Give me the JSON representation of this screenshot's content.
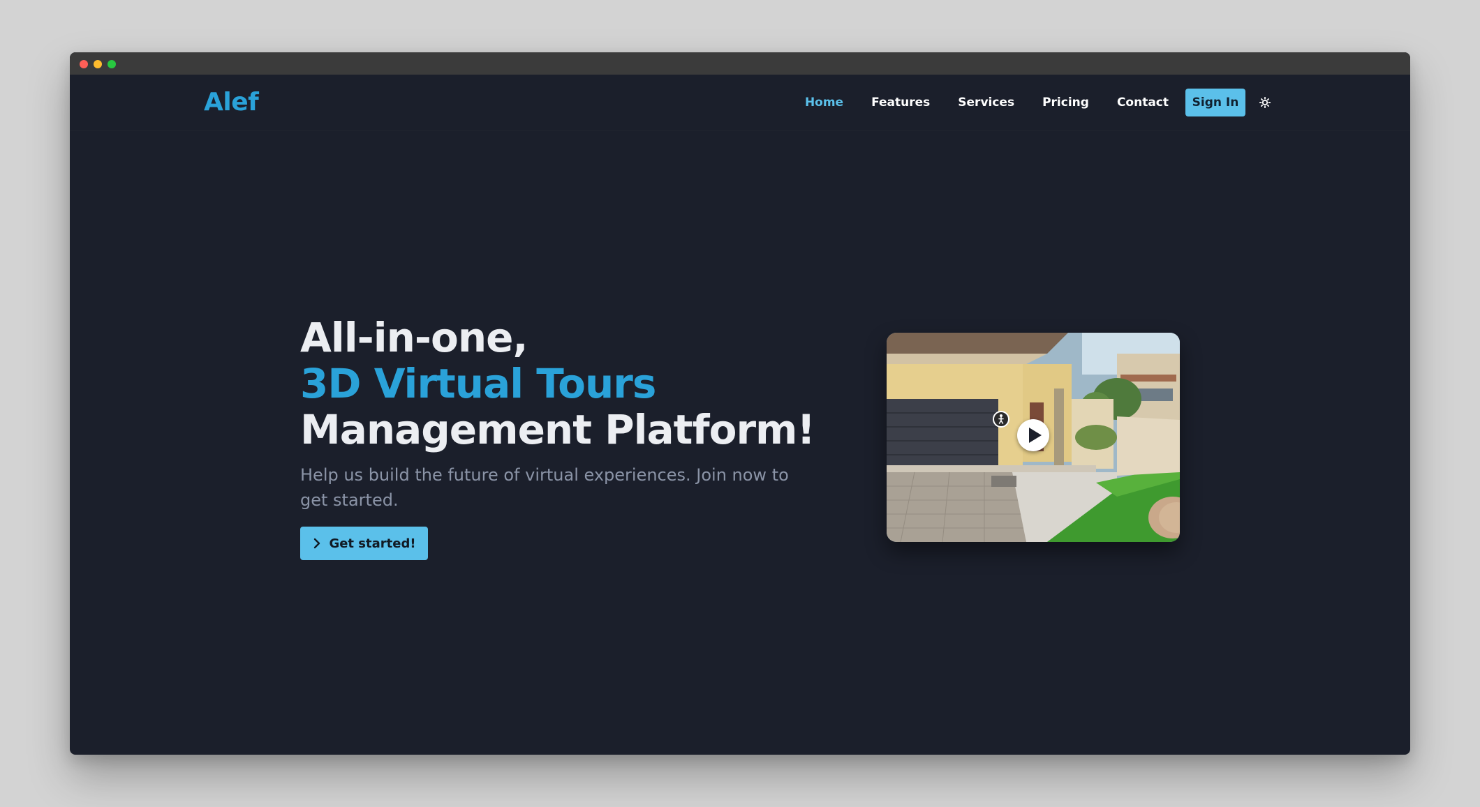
{
  "nav": {
    "logo": "Alef",
    "links": [
      "Home",
      "Features",
      "Services",
      "Pricing",
      "Contact"
    ],
    "active": "Home",
    "signin_label": "Sign In",
    "theme_icon": "sun-icon"
  },
  "hero": {
    "line1": "All-in-one,",
    "line2": "3D Virtual Tours",
    "line3": "Management Platform!",
    "subtitle": "Help us build the future of virtual experiences. Join now to get started.",
    "cta_label": "Get started!",
    "cta_icon": "chevron-right-icon"
  },
  "media": {
    "play_icon": "play-icon",
    "walk_icon": "person-walk-icon"
  },
  "colors": {
    "background": "#1b1f2b",
    "accent": "#2aa2d9",
    "button": "#5bc0ea",
    "text": "#eceef2",
    "muted": "#8b94a7"
  }
}
